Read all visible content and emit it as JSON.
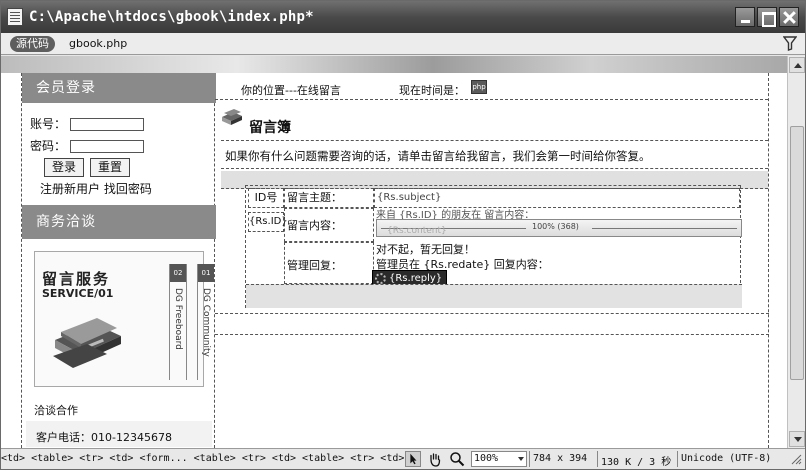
{
  "window": {
    "title": "C:\\Apache\\htdocs\\gbook\\index.php*"
  },
  "toolbar": {
    "source_label": "源代码",
    "file_tab": "gbook.php"
  },
  "sidebar": {
    "login_title": "会员登录",
    "account_label": "账号：",
    "password_label": "密码：",
    "login_button": "登录",
    "reset_button": "重置",
    "links_text": "注册新用户 找回密码",
    "business_title": "商务洽谈",
    "promo": {
      "title_line1": "留言服务",
      "title_line2": "SERVICE/01",
      "strip1_num": "02",
      "strip1_text": "DG Freeboard",
      "strip2_num": "01",
      "strip2_text": "DG Community"
    },
    "cooperation": "洽谈合作",
    "phone": "客户电话：010-12345678"
  },
  "main": {
    "location": "你的位置---在线留言",
    "time_label": "现在时间是：",
    "php_badge": "php",
    "guestbook_title": "留言簿",
    "intro": "如果你有什么问题需要咨询的话，请单击留言给我留言，我们会第一时间给你答复。",
    "table": {
      "id_header": "ID号",
      "subject_label": "留言主题：",
      "subject_value": "{Rs.subject}",
      "id_value": "{Rs.ID}",
      "content_label": "留言内容：",
      "content_intro": "来自 {Rs.ID} 的朋友在 留言内容：",
      "placeholder_label": "100% (368)",
      "content_value": "{Rs.content}",
      "reply_label": "管理回复：",
      "reply_line1": "对不起，暂无回复！",
      "reply_line2": "管理员在 {Rs.redate} 回复内容：",
      "reply_value": "{Rs.reply}"
    }
  },
  "statusbar": {
    "tag_path": "<td> <table> <tr> <td> <form... <table> <tr> <td> <table> <tr> <td>",
    "zoom": "100%",
    "dimensions": "784 x 394",
    "filesize": "130 K / 3 秒",
    "encoding": "Unicode (UTF-8)"
  },
  "colors": {
    "section_header": "#8a8a8a",
    "title_bar": "#4a4a4a"
  }
}
